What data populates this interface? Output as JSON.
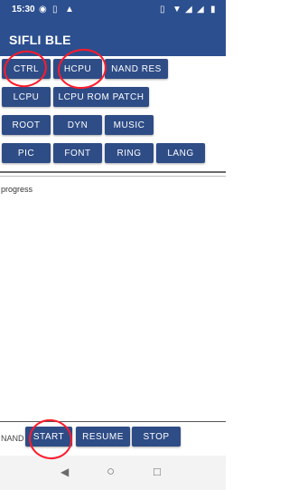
{
  "status": {
    "time": "15:30"
  },
  "appbar": {
    "title": "SIFLI BLE"
  },
  "buttons": {
    "ctrl": "CTRL",
    "hcpu": "HCPU",
    "nand_res": "NAND RES",
    "lcpu": "LCPU",
    "lcpu_rom_patch": "LCPU ROM PATCH",
    "root": "ROOT",
    "dyn": "DYN",
    "music": "MUSIC",
    "pic": "PIC",
    "font": "FONT",
    "ring": "RING",
    "lang": "LANG"
  },
  "progress_label": "progress",
  "bottom": {
    "nand_label": "NAND",
    "start": "START",
    "resume": "RESUME",
    "stop": "STOP"
  },
  "annotation_color": "#ff1a2a",
  "accent_color": "#2c4f8f"
}
